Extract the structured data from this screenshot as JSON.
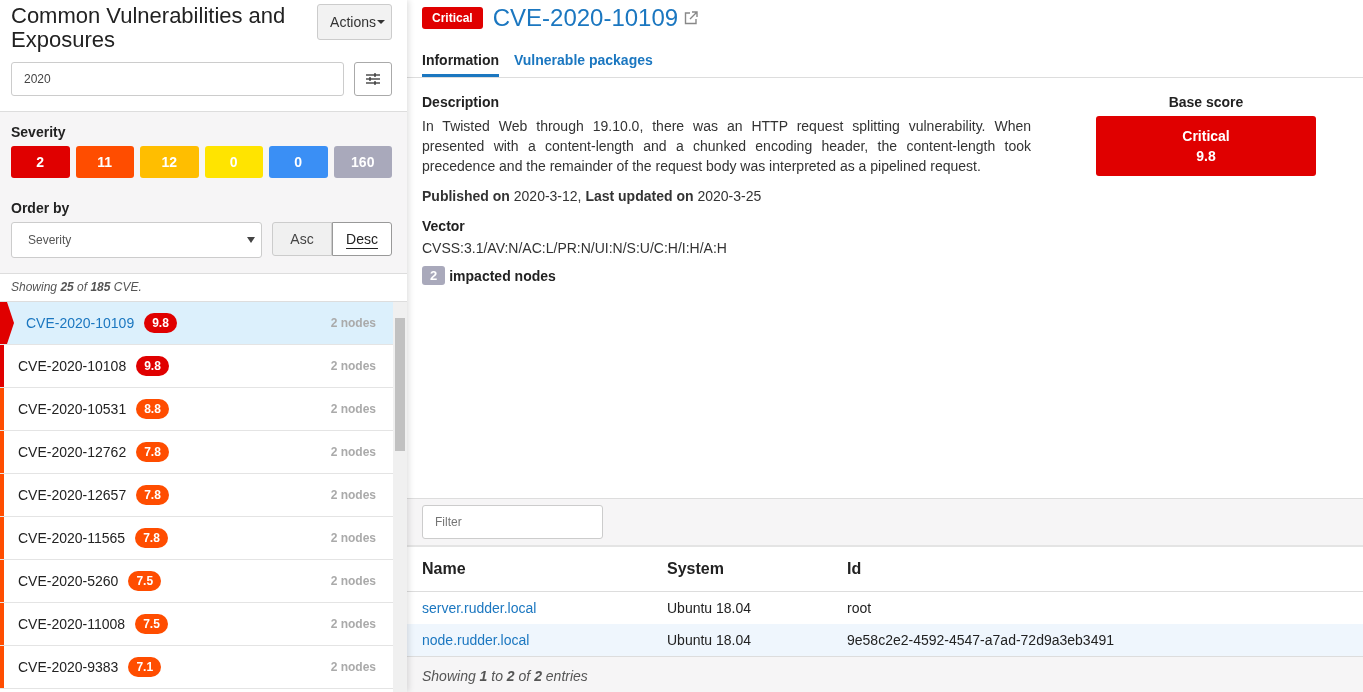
{
  "sidebar": {
    "title": "Common Vulnerabilities and Exposures",
    "actions_button": "Actions",
    "search": {
      "value": "2020"
    },
    "severity": {
      "label": "Severity",
      "levels": [
        {
          "count": "2",
          "color": "#e00000"
        },
        {
          "count": "11",
          "color": "#ff4d00"
        },
        {
          "count": "12",
          "color": "#ffbe00"
        },
        {
          "count": "0",
          "color": "#ffe400"
        },
        {
          "count": "0",
          "color": "#3a8ff5"
        },
        {
          "count": "160",
          "color": "#a9a9bb"
        }
      ]
    },
    "order": {
      "label": "Order by",
      "select": "Severity",
      "directions": [
        {
          "label": "Asc",
          "selected": false
        },
        {
          "label": "Desc",
          "selected": true
        }
      ]
    },
    "summary": "Showing **25** of **185** CVE.",
    "items": [
      {
        "id": "CVE-2020-10109",
        "score": "9.8",
        "nodes": "2 nodes",
        "color": "#e00000",
        "selected": true
      },
      {
        "id": "CVE-2020-10108",
        "score": "9.8",
        "nodes": "2 nodes",
        "color": "#e00000",
        "selected": false
      },
      {
        "id": "CVE-2020-10531",
        "score": "8.8",
        "nodes": "2 nodes",
        "color": "#ff4d00",
        "selected": false
      },
      {
        "id": "CVE-2020-12762",
        "score": "7.8",
        "nodes": "2 nodes",
        "color": "#ff4d00",
        "selected": false
      },
      {
        "id": "CVE-2020-12657",
        "score": "7.8",
        "nodes": "2 nodes",
        "color": "#ff4d00",
        "selected": false
      },
      {
        "id": "CVE-2020-11565",
        "score": "7.8",
        "nodes": "2 nodes",
        "color": "#ff4d00",
        "selected": false
      },
      {
        "id": "CVE-2020-5260",
        "score": "7.5",
        "nodes": "2 nodes",
        "color": "#ff4d00",
        "selected": false
      },
      {
        "id": "CVE-2020-11008",
        "score": "7.5",
        "nodes": "2 nodes",
        "color": "#ff4d00",
        "selected": false
      },
      {
        "id": "CVE-2020-9383",
        "score": "7.1",
        "nodes": "2 nodes",
        "color": "#ff4d00",
        "selected": false
      }
    ]
  },
  "detail": {
    "severity_badge": "Critical",
    "title": "CVE-2020-10109",
    "tabs": [
      {
        "label": "Information",
        "selected": true
      },
      {
        "label": "Vulnerable packages",
        "selected": false
      }
    ],
    "description_label": "Description",
    "description": "In Twisted Web through 19.10.0, there was an HTTP request splitting vulnerability. When presented with a content-length and a chunked encoding header, the content-length took precedence and the remainder of the request body was interpreted as a pipelined request.",
    "dates": "**Published on** 2020-3-12, **Last updated on** 2020-3-25",
    "vector_label": "Vector",
    "vector": "CVSS:3.1/AV:N/AC:L/PR:N/UI:N/S:U/C:H/I:H/A:H",
    "impacted_count": "2",
    "impacted_label": "impacted nodes",
    "base_score": {
      "label": "Base score",
      "severity": "Critical",
      "value": "9.8"
    }
  },
  "nodes_table": {
    "filter": {
      "placeholder": "Filter"
    },
    "columns": [
      "Name",
      "System",
      "Id"
    ],
    "rows": [
      {
        "name": "server.rudder.local",
        "system": "Ubuntu 18.04",
        "id": "root",
        "selected": false
      },
      {
        "name": "node.rudder.local",
        "system": "Ubuntu 18.04",
        "id": "9e58c2e2-4592-4547-a7ad-72d9a3eb3491",
        "selected": true
      }
    ],
    "footer": "Showing **1** to **2** of **2** entries"
  }
}
